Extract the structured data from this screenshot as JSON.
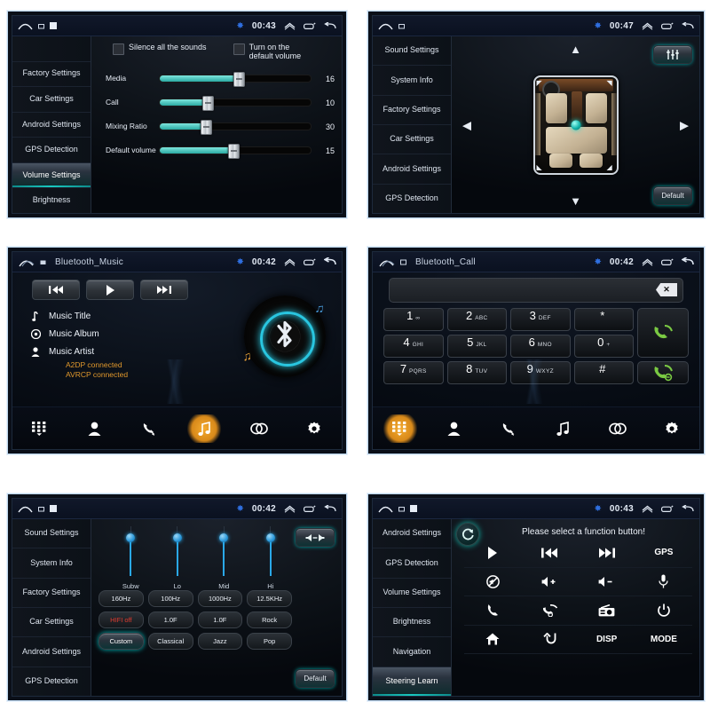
{
  "meta": {
    "accent_teal": "#19c9c0",
    "accent_orange": "#e0982c",
    "accent_blue": "#2aa8e8",
    "bg": "#ffffff"
  },
  "panels": {
    "volume_settings": {
      "status": {
        "time": "00:43",
        "bluetooth_icon": "bluetooth-icon",
        "home_icon": "home-icon",
        "expand_icon": "expand-up-icon",
        "recents_icon": "recents-icon",
        "back_icon": "back-icon"
      },
      "sidebar": [
        {
          "label": "",
          "partial": true,
          "active": false
        },
        {
          "label": "Factory Settings",
          "active": false
        },
        {
          "label": "Car Settings",
          "active": false
        },
        {
          "label": "Android Settings",
          "active": false
        },
        {
          "label": "GPS Detection",
          "active": false
        },
        {
          "label": "Volume Settings",
          "active": true
        },
        {
          "label": "Brightness",
          "active": false
        }
      ],
      "checkboxes": [
        {
          "label": "Silence all the sounds",
          "checked": false
        },
        {
          "label": "Turn on the default volume",
          "checked": false
        }
      ],
      "sliders": [
        {
          "label": "Media",
          "value": 16,
          "percent": 52
        },
        {
          "label": "Call",
          "value": 10,
          "percent": 31
        },
        {
          "label": "Mixing Ratio",
          "value": 30,
          "percent": 30
        },
        {
          "label": "Default volume",
          "value": 15,
          "percent": 48
        }
      ]
    },
    "car_settings": {
      "status": {
        "time": "00:47"
      },
      "sidebar": [
        {
          "label": "Sound Settings",
          "active": false
        },
        {
          "label": "System Info",
          "active": false
        },
        {
          "label": "Factory Settings",
          "active": false
        },
        {
          "label": "Car Settings",
          "active": false
        },
        {
          "label": "Android Settings",
          "active": false
        },
        {
          "label": "GPS Detection",
          "active": false
        }
      ],
      "buttons": {
        "eq_icon": "equalizer-icon",
        "default_label": "Default"
      },
      "arrows": {
        "up": "▲",
        "down": "▼",
        "left": "◀",
        "right": "▶"
      }
    },
    "bluetooth_music": {
      "status": {
        "time": "00:42"
      },
      "title": "Bluetooth_Music",
      "transport": [
        {
          "icon": "previous-track-icon",
          "glyph": "⏮"
        },
        {
          "icon": "play-icon",
          "glyph": "▶"
        },
        {
          "icon": "next-track-icon",
          "glyph": "⏭"
        }
      ],
      "metadata": [
        {
          "icon": "music-title-icon",
          "label": "Music Title"
        },
        {
          "icon": "music-album-icon",
          "label": "Music Album"
        },
        {
          "icon": "music-artist-icon",
          "label": "Music Artist"
        }
      ],
      "connections": [
        "A2DP connected",
        "AVRCP connected"
      ],
      "nav": [
        {
          "icon": "dialpad-icon",
          "active": false
        },
        {
          "icon": "contacts-icon",
          "active": false
        },
        {
          "icon": "call-history-icon",
          "active": false
        },
        {
          "icon": "music-icon",
          "active": true
        },
        {
          "icon": "link-icon",
          "active": false
        },
        {
          "icon": "settings-gear-icon",
          "active": false
        }
      ]
    },
    "bluetooth_call": {
      "status": {
        "time": "00:42"
      },
      "title": "Bluetooth_Call",
      "number_value": "",
      "backspace_icon": "backspace-icon",
      "keys": [
        {
          "num": "1",
          "sub": "∞"
        },
        {
          "num": "2",
          "sub": "ABC"
        },
        {
          "num": "3",
          "sub": "DEF"
        },
        {
          "num": "*",
          "sub": ""
        },
        {
          "num": "4",
          "sub": "GHI"
        },
        {
          "num": "5",
          "sub": "JKL"
        },
        {
          "num": "6",
          "sub": "MNO"
        },
        {
          "num": "0",
          "sub": "+"
        },
        {
          "num": "7",
          "sub": "PQRS"
        },
        {
          "num": "8",
          "sub": "TUV"
        },
        {
          "num": "9",
          "sub": "WXYZ"
        },
        {
          "num": "#",
          "sub": ""
        }
      ],
      "call_buttons": [
        {
          "icon": "answer-call-icon",
          "color": "#7ac943"
        },
        {
          "icon": "hangup-call-icon",
          "color": "#7ac943"
        }
      ],
      "nav": [
        {
          "icon": "dialpad-icon",
          "active": true
        },
        {
          "icon": "contacts-icon",
          "active": false
        },
        {
          "icon": "call-history-icon",
          "active": false
        },
        {
          "icon": "music-icon",
          "active": false
        },
        {
          "icon": "link-icon",
          "active": false
        },
        {
          "icon": "settings-gear-icon",
          "active": false
        }
      ]
    },
    "sound_settings": {
      "status": {
        "time": "00:42"
      },
      "sidebar": [
        {
          "label": "Sound Settings",
          "active": false
        },
        {
          "label": "System Info",
          "active": false
        },
        {
          "label": "Factory Settings",
          "active": false
        },
        {
          "label": "Car Settings",
          "active": false
        },
        {
          "label": "Android Settings",
          "active": false
        },
        {
          "label": "GPS Detection",
          "active": false
        }
      ],
      "eq_sliders": [
        {
          "label": "Subw",
          "percent": 78
        },
        {
          "label": "Lo",
          "percent": 78
        },
        {
          "label": "Mid",
          "percent": 78
        },
        {
          "label": "Hi",
          "percent": 78
        }
      ],
      "rows": [
        [
          {
            "label": "160Hz"
          },
          {
            "label": "100Hz"
          },
          {
            "label": "1000Hz"
          },
          {
            "label": "12.5KHz"
          }
        ],
        [
          {
            "label": "HIFI off",
            "red": true
          },
          {
            "label": "1.0F"
          },
          {
            "label": "1.0F"
          },
          {
            "label": "Rock"
          }
        ],
        [
          {
            "label": "Custom",
            "selected": true
          },
          {
            "label": "Classical"
          },
          {
            "label": "Jazz"
          },
          {
            "label": "Pop"
          }
        ]
      ],
      "balance_icon": "balance-icon",
      "default_label": "Default"
    },
    "steering_learn": {
      "status": {
        "time": "00:43"
      },
      "sidebar": [
        {
          "label": "Android Settings",
          "active": false
        },
        {
          "label": "GPS Detection",
          "active": false
        },
        {
          "label": "Volume Settings",
          "active": false
        },
        {
          "label": "Brightness",
          "active": false
        },
        {
          "label": "Navigation",
          "active": false
        },
        {
          "label": "Steering Learn",
          "active": true
        }
      ],
      "refresh_icon": "refresh-icon",
      "prompt": "Please select a function button!",
      "functions": [
        {
          "icon": "play-icon",
          "label": ""
        },
        {
          "icon": "previous-track-icon",
          "label": ""
        },
        {
          "icon": "next-track-icon",
          "label": ""
        },
        {
          "icon": "gps-icon",
          "label": "GPS"
        },
        {
          "icon": "mute-icon",
          "label": ""
        },
        {
          "icon": "volume-up-icon",
          "label": ""
        },
        {
          "icon": "volume-down-icon",
          "label": ""
        },
        {
          "icon": "microphone-icon",
          "label": ""
        },
        {
          "icon": "call-icon",
          "label": ""
        },
        {
          "icon": "hangup-icon",
          "label": ""
        },
        {
          "icon": "radio-icon",
          "label": ""
        },
        {
          "icon": "power-icon",
          "label": ""
        },
        {
          "icon": "home-icon",
          "label": ""
        },
        {
          "icon": "back-icon",
          "label": ""
        },
        {
          "icon": "disp-icon",
          "label": "DISP"
        },
        {
          "icon": "mode-icon",
          "label": "MODE"
        }
      ]
    }
  }
}
